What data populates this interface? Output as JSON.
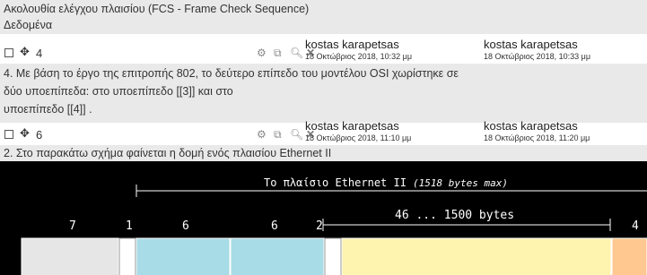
{
  "header": {
    "line1": "Ακολουθία ελέγχου πλαισίου (FCS - Frame Check Sequence)",
    "line2": "Δεδομένα"
  },
  "rows": [
    {
      "number": "4",
      "user1": "kostas karapetsas",
      "date1": "18 Οκτώβριος 2018, 10:32 μμ",
      "user2": "kostas karapetsas",
      "date2": "18 Οκτώβριος 2018, 10:33 μμ",
      "content": [
        "4. Με βάση το έργο της επιτροπής 802, το δεύτερο επίπεδο του μοντέλου OSI χωρίστηκε σε",
        "δύο υποεπίπεδα: στο υποεπίπεδο [[3]] και στο",
        "υποεπίπεδο [[4]] ."
      ]
    },
    {
      "number": "6",
      "user1": "kostas karapetsas",
      "date1": "18 Οκτώβριος 2018, 11:10 μμ",
      "user2": "kostas karapetsas",
      "date2": "18 Οκτώβριος 2018, 11:20 μμ",
      "content": [
        "2. Στο παρακάτω σχήμα φαίνεται η δομή ενός πλαισίου Ethernet II"
      ]
    }
  ],
  "icons": [
    "move-icon",
    "gear-icon",
    "copy-icon",
    "preview-icon",
    "delete-icon"
  ],
  "diagram": {
    "title": "Το πλαίσιο Ethernet II",
    "title_note": "(1518 bytes max)",
    "span_label": "46 ... 1500 bytes",
    "field_sizes": [
      "7",
      "1",
      "6",
      "6",
      "2",
      "4"
    ],
    "colors": {
      "background": "#000000",
      "preamble": "#e6e6e6",
      "sfd": "#ffffff",
      "dst": "#a8dce6",
      "src": "#a8dce6",
      "type": "#ffffff",
      "data": "#fff3b0",
      "fcs": "#ffc890"
    }
  }
}
